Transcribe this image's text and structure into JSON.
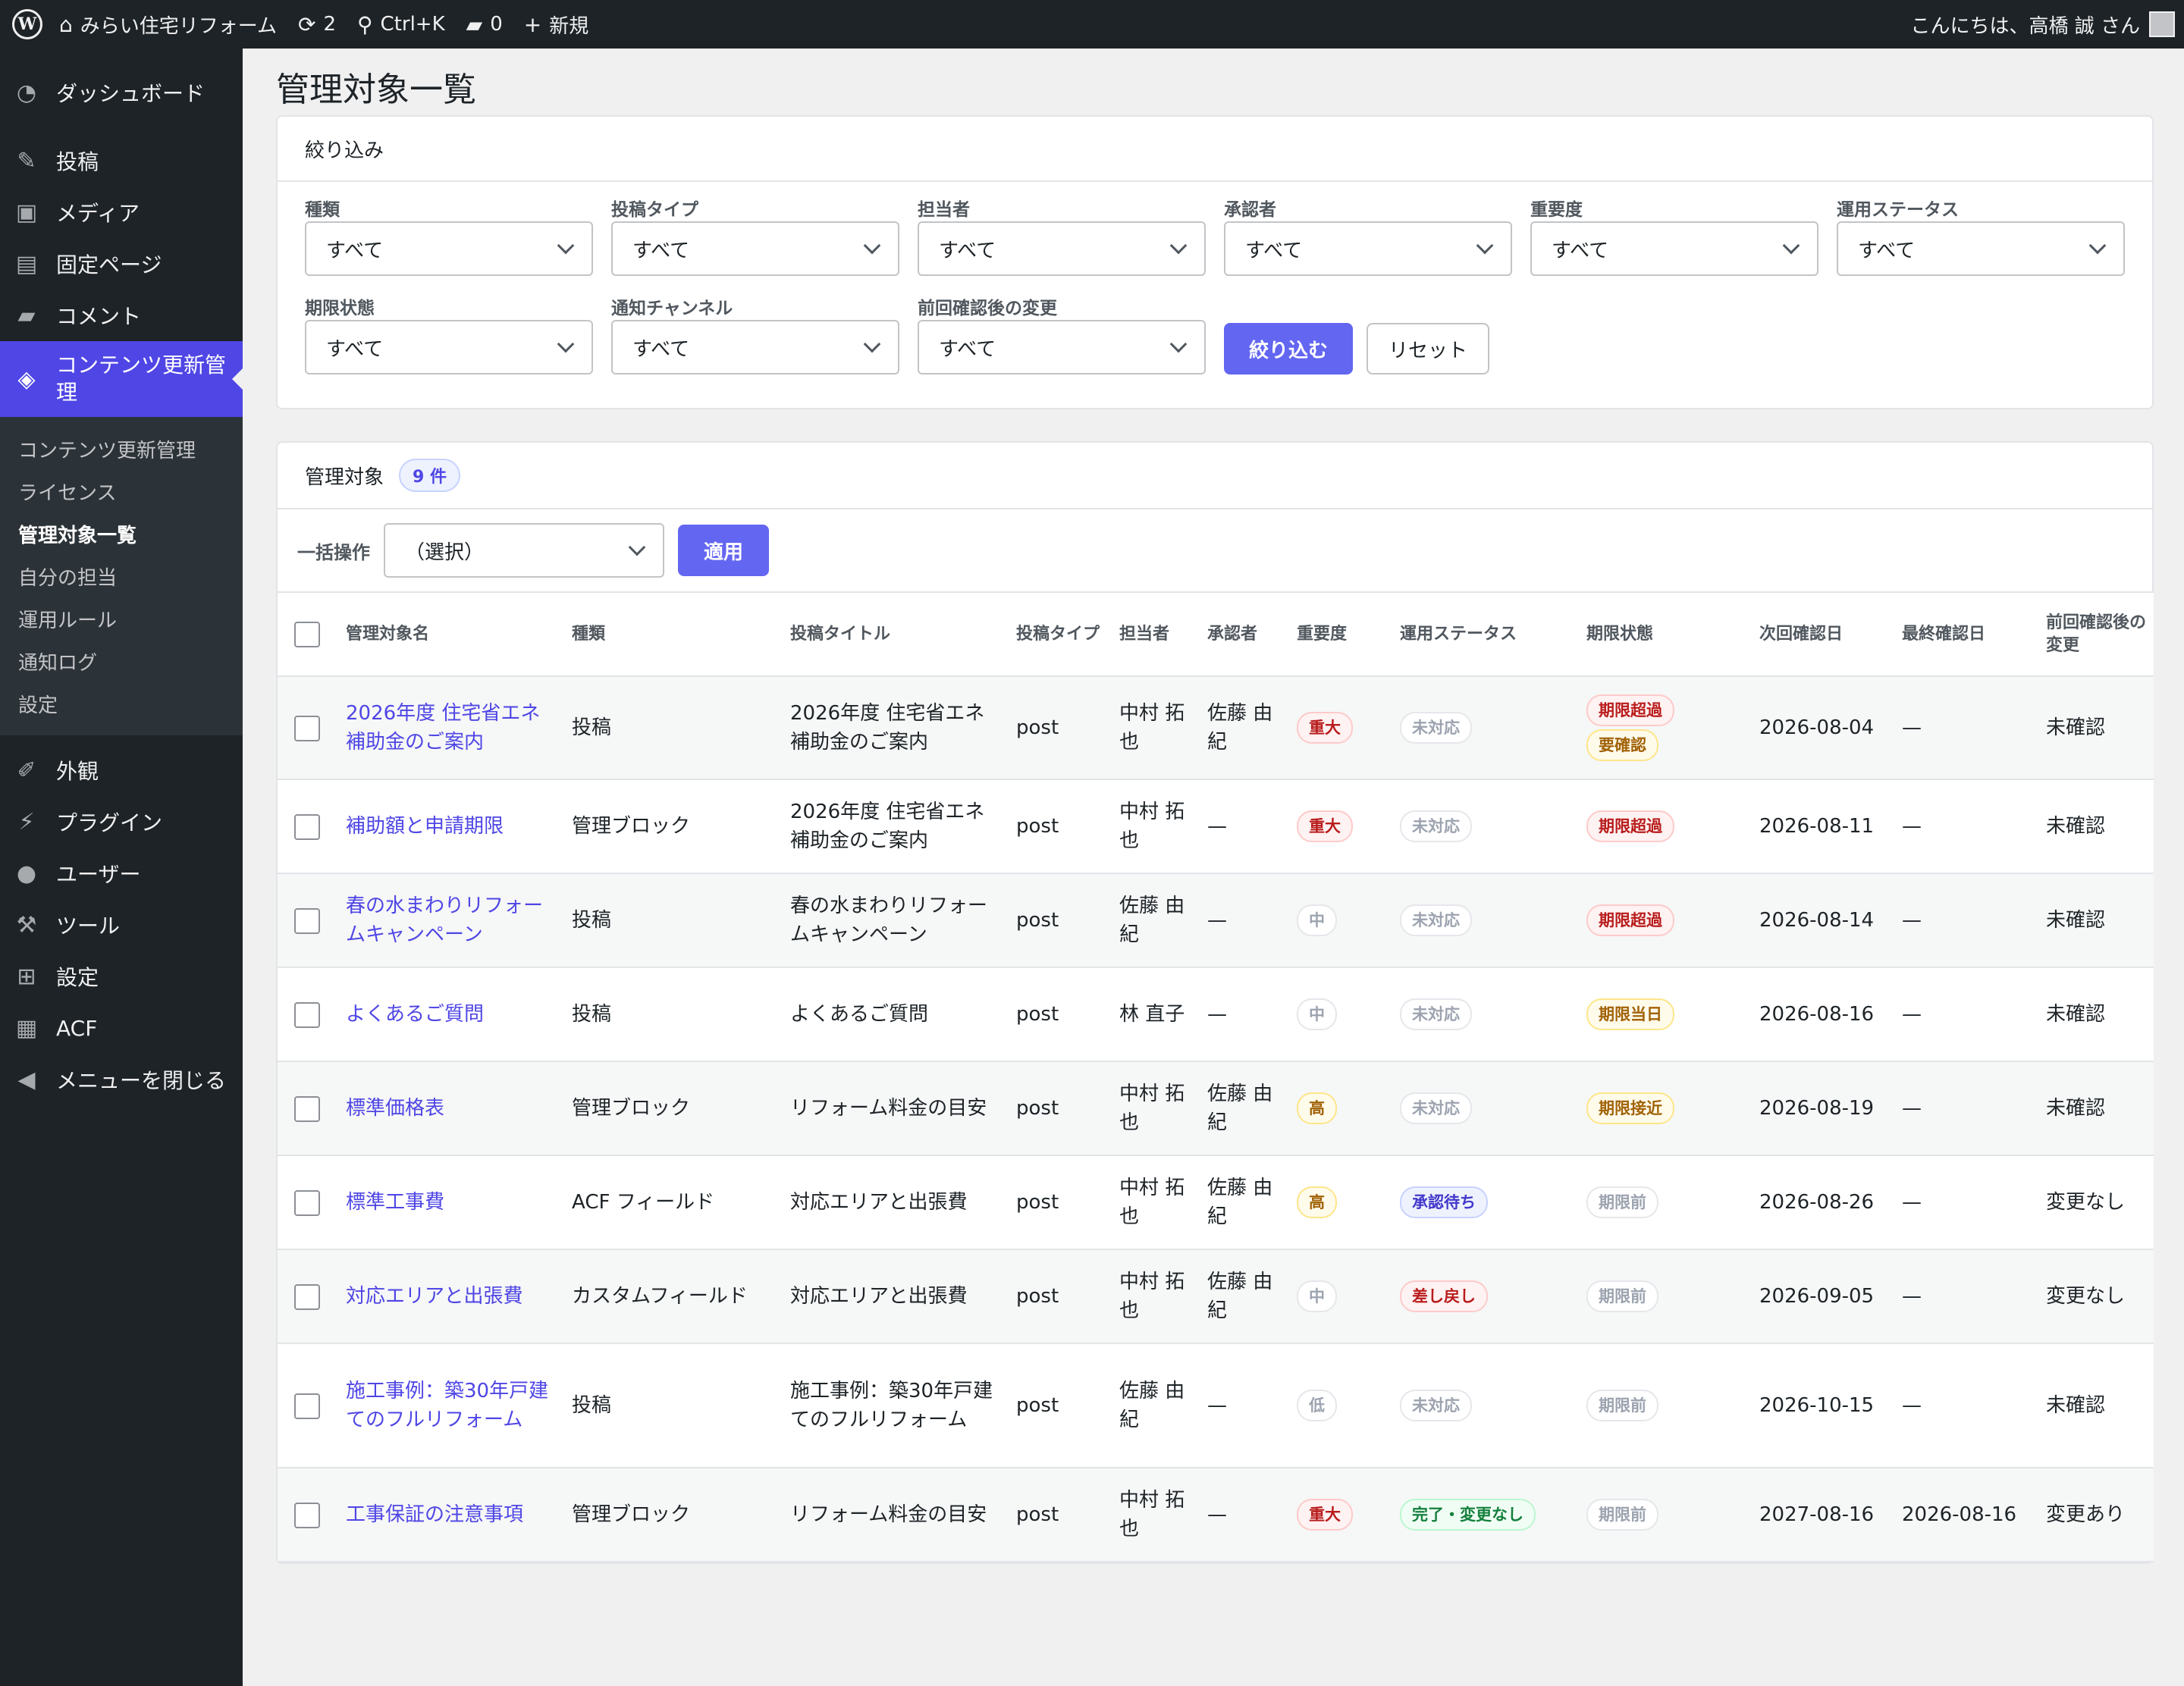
{
  "adminbar": {
    "site_name": "みらい住宅リフォーム",
    "updates_count": "2",
    "search_shortcut": "Ctrl+K",
    "comments_count": "0",
    "new_label": "新規",
    "greeting": "こんにちは、高橋 誠 さん"
  },
  "sidebar": {
    "items": [
      {
        "label": "ダッシュボード",
        "icon": "dashboard-icon"
      },
      {
        "label": "投稿",
        "icon": "pin-icon"
      },
      {
        "label": "メディア",
        "icon": "media-icon"
      },
      {
        "label": "固定ページ",
        "icon": "page-icon"
      },
      {
        "label": "コメント",
        "icon": "comment-icon"
      },
      {
        "label": "コンテンツ更新管理",
        "icon": "tag-icon"
      }
    ],
    "submenu": [
      "コンテンツ更新管理",
      "ライセンス",
      "管理対象一覧",
      "自分の担当",
      "運用ルール",
      "通知ログ",
      "設定"
    ],
    "items_bottom": [
      {
        "label": "外観",
        "icon": "brush-icon"
      },
      {
        "label": "プラグイン",
        "icon": "plugin-icon"
      },
      {
        "label": "ユーザー",
        "icon": "user-icon"
      },
      {
        "label": "ツール",
        "icon": "wrench-icon"
      },
      {
        "label": "設定",
        "icon": "settings-icon"
      },
      {
        "label": "ACF",
        "icon": "table-icon"
      },
      {
        "label": "メニューを閉じる",
        "icon": "collapse-icon"
      }
    ]
  },
  "page": {
    "title": "管理対象一覧"
  },
  "filters": {
    "title": "絞り込み",
    "fields": [
      {
        "label": "種類",
        "value": "すべて"
      },
      {
        "label": "投稿タイプ",
        "value": "すべて"
      },
      {
        "label": "担当者",
        "value": "すべて"
      },
      {
        "label": "承認者",
        "value": "すべて"
      },
      {
        "label": "重要度",
        "value": "すべて"
      },
      {
        "label": "運用ステータス",
        "value": "すべて"
      },
      {
        "label": "期限状態",
        "value": "すべて"
      },
      {
        "label": "通知チャンネル",
        "value": "すべて"
      },
      {
        "label": "前回確認後の変更",
        "value": "すべて"
      }
    ],
    "submit_label": "絞り込む",
    "reset_label": "リセット"
  },
  "list": {
    "title": "管理対象",
    "count": "9 件",
    "bulk_label": "一括操作",
    "bulk_value": "（選択）",
    "apply_label": "適用",
    "columns": [
      "管理対象名",
      "種類",
      "投稿タイトル",
      "投稿タイプ",
      "担当者",
      "承認者",
      "重要度",
      "運用ステータス",
      "期限状態",
      "次回確認日",
      "最終確認日",
      "前回確認後の変更"
    ],
    "rows": [
      {
        "name": "2026年度 住宅省エネ補助金のご案内",
        "kind": "投稿",
        "post_title": "2026年度 住宅省エネ補助金のご案内",
        "post_type": "post",
        "assignee": "中村 拓也",
        "approver": "佐藤 由紀",
        "importance": "重大",
        "status": "未対応",
        "deadline": [
          "期限超過",
          "要確認"
        ],
        "next": "2026-08-04",
        "last": "—",
        "change": "未確認"
      },
      {
        "name": "補助額と申請期限",
        "kind": "管理ブロック",
        "post_title": "2026年度 住宅省エネ補助金のご案内",
        "post_type": "post",
        "assignee": "中村 拓也",
        "approver": "—",
        "importance": "重大",
        "status": "未対応",
        "deadline": [
          "期限超過"
        ],
        "next": "2026-08-11",
        "last": "—",
        "change": "未確認"
      },
      {
        "name": "春の水まわりリフォームキャンペーン",
        "kind": "投稿",
        "post_title": "春の水まわりリフォームキャンペーン",
        "post_type": "post",
        "assignee": "佐藤 由紀",
        "approver": "—",
        "importance": "中",
        "status": "未対応",
        "deadline": [
          "期限超過"
        ],
        "next": "2026-08-14",
        "last": "—",
        "change": "未確認"
      },
      {
        "name": "よくあるご質問",
        "kind": "投稿",
        "post_title": "よくあるご質問",
        "post_type": "post",
        "assignee": "林 直子",
        "approver": "—",
        "importance": "中",
        "status": "未対応",
        "deadline": [
          "期限当日"
        ],
        "next": "2026-08-16",
        "last": "—",
        "change": "未確認"
      },
      {
        "name": "標準価格表",
        "kind": "管理ブロック",
        "post_title": "リフォーム料金の目安",
        "post_type": "post",
        "assignee": "中村 拓也",
        "approver": "佐藤 由紀",
        "importance": "高",
        "status": "未対応",
        "deadline": [
          "期限接近"
        ],
        "next": "2026-08-19",
        "last": "—",
        "change": "未確認"
      },
      {
        "name": "標準工事費",
        "kind": "ACF フィールド",
        "post_title": "対応エリアと出張費",
        "post_type": "post",
        "assignee": "中村 拓也",
        "approver": "佐藤 由紀",
        "importance": "高",
        "status": "承認待ち",
        "deadline": [
          "期限前"
        ],
        "next": "2026-08-26",
        "last": "—",
        "change": "変更なし"
      },
      {
        "name": "対応エリアと出張費",
        "kind": "カスタムフィールド",
        "post_title": "対応エリアと出張費",
        "post_type": "post",
        "assignee": "中村 拓也",
        "approver": "佐藤 由紀",
        "importance": "中",
        "status": "差し戻し",
        "deadline": [
          "期限前"
        ],
        "next": "2026-09-05",
        "last": "—",
        "change": "変更なし"
      },
      {
        "name": "施工事例：築30年戸建てのフルリフォーム",
        "kind": "投稿",
        "post_title": "施工事例：築30年戸建てのフルリフォーム",
        "post_type": "post",
        "assignee": "佐藤 由紀",
        "approver": "—",
        "importance": "低",
        "status": "未対応",
        "deadline": [
          "期限前"
        ],
        "next": "2026-10-15",
        "last": "—",
        "change": "未確認"
      },
      {
        "name": "工事保証の注意事項",
        "kind": "管理ブロック",
        "post_title": "リフォーム料金の目安",
        "post_type": "post",
        "assignee": "中村 拓也",
        "approver": "—",
        "importance": "重大",
        "status": "完了・変更なし",
        "deadline": [
          "期限前"
        ],
        "next": "2027-08-16",
        "last": "2026-08-16",
        "change": "変更あり"
      }
    ]
  }
}
